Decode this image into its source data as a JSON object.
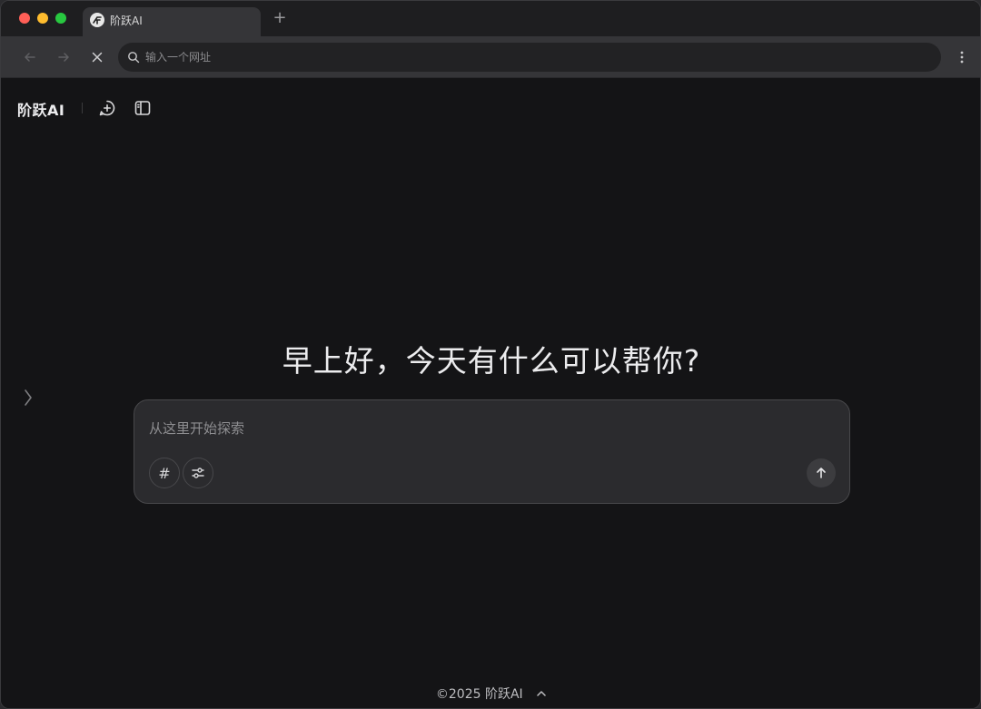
{
  "browser": {
    "tab": {
      "title": "阶跃AI",
      "favicon": "stepfun-logo-icon"
    },
    "new_tab_label": "+",
    "omnibox": {
      "placeholder": "输入一个网址",
      "value": ""
    }
  },
  "app": {
    "brand": "阶跃AI",
    "icons": {
      "new_chat": "new-chat-icon",
      "sidebar": "sidebar-toggle-icon",
      "expand": "chevron-right-icon"
    }
  },
  "main": {
    "greeting": "早上好，今天有什么可以帮你?",
    "composer": {
      "placeholder": "从这里开始探索",
      "value": "",
      "hash_label": "#",
      "send_icon": "arrow-up-icon",
      "settings_icon": "sliders-icon"
    }
  },
  "footer": {
    "text": "©2025 阶跃AI"
  },
  "colors": {
    "background": "#141416",
    "composer_bg": "#2b2b2e",
    "text_primary": "#ececee",
    "text_muted": "#8e8e91"
  }
}
